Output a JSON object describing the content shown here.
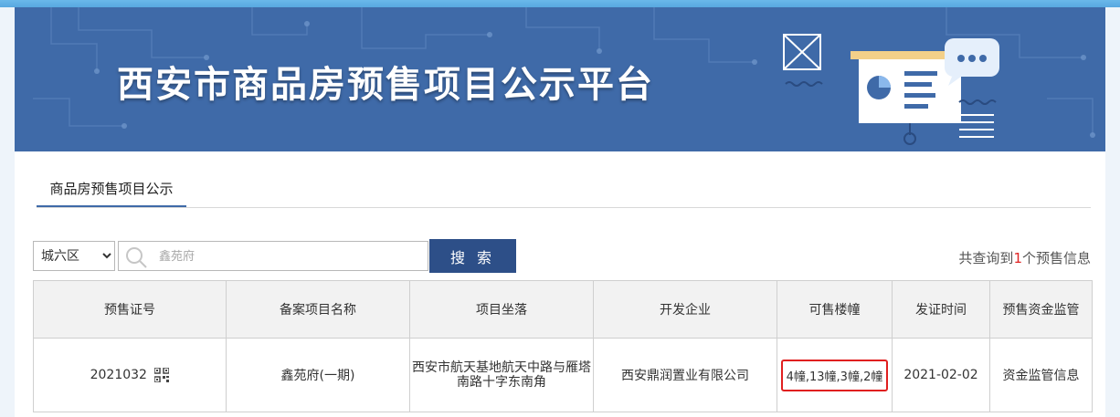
{
  "banner": {
    "title": "西安市商品房预售项目公示平台"
  },
  "tabs": [
    {
      "label": "商品房预售项目公示",
      "active": true
    }
  ],
  "search": {
    "district_selected": "城六区",
    "district_options": [
      "城六区"
    ],
    "placeholder": "鑫苑府",
    "button_label": "搜 索"
  },
  "result_summary": {
    "prefix": "共查询到",
    "count": "1",
    "suffix": "个预售信息"
  },
  "table": {
    "headers": [
      "预售证号",
      "备案项目名称",
      "项目坐落",
      "开发企业",
      "可售楼幢",
      "发证时间",
      "预售资金监管"
    ],
    "rows": [
      {
        "cert_no": "2021032",
        "project_name": "鑫苑府(一期)",
        "location": "西安市航天基地航天中路与雁塔南路十字东南角",
        "developer": "西安鼎润置业有限公司",
        "buildings": "4幢,13幢,3幢,2幢",
        "issue_date": "2021-02-02",
        "fund_supervision": "资金监管信息"
      }
    ]
  },
  "colors": {
    "banner_bg": "#3f6aa8",
    "button_bg": "#2d4f88",
    "highlight_red": "#e01f1f"
  }
}
